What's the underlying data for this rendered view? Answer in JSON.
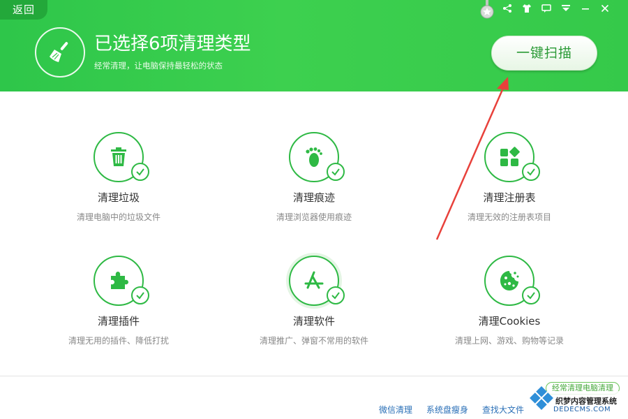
{
  "header": {
    "back_label": "返回",
    "title": "已选择6项清理类型",
    "subtitle": "经常清理，让电脑保持最轻松的状态",
    "scan_label": "一键扫描",
    "accent_color": "#35c94a"
  },
  "title_controls": [
    "medal-icon",
    "share-icon",
    "skin-icon",
    "message-icon",
    "menu-icon",
    "minimize-icon",
    "close-icon"
  ],
  "items": [
    {
      "title": "清理垃圾",
      "desc": "清理电脑中的垃圾文件",
      "icon": "trash-icon"
    },
    {
      "title": "清理痕迹",
      "desc": "清理浏览器使用痕迹",
      "icon": "footprint-icon"
    },
    {
      "title": "清理注册表",
      "desc": "清理无效的注册表项目",
      "icon": "registry-icon"
    },
    {
      "title": "清理插件",
      "desc": "清理无用的插件、降低打扰",
      "icon": "puzzle-icon"
    },
    {
      "title": "清理软件",
      "desc": "清理推广、弹窗不常用的软件",
      "icon": "app-store-icon"
    },
    {
      "title": "清理Cookies",
      "desc": "清理上网、游戏、购物等记录",
      "icon": "cookie-icon"
    }
  ],
  "footer": {
    "links": [
      "微信清理",
      "系统盘瘦身",
      "查找大文件"
    ]
  },
  "watermark": {
    "badge": "经常清理电脑清理",
    "line1": "织梦内容管理系统",
    "line2": "DEDECMS.COM"
  }
}
